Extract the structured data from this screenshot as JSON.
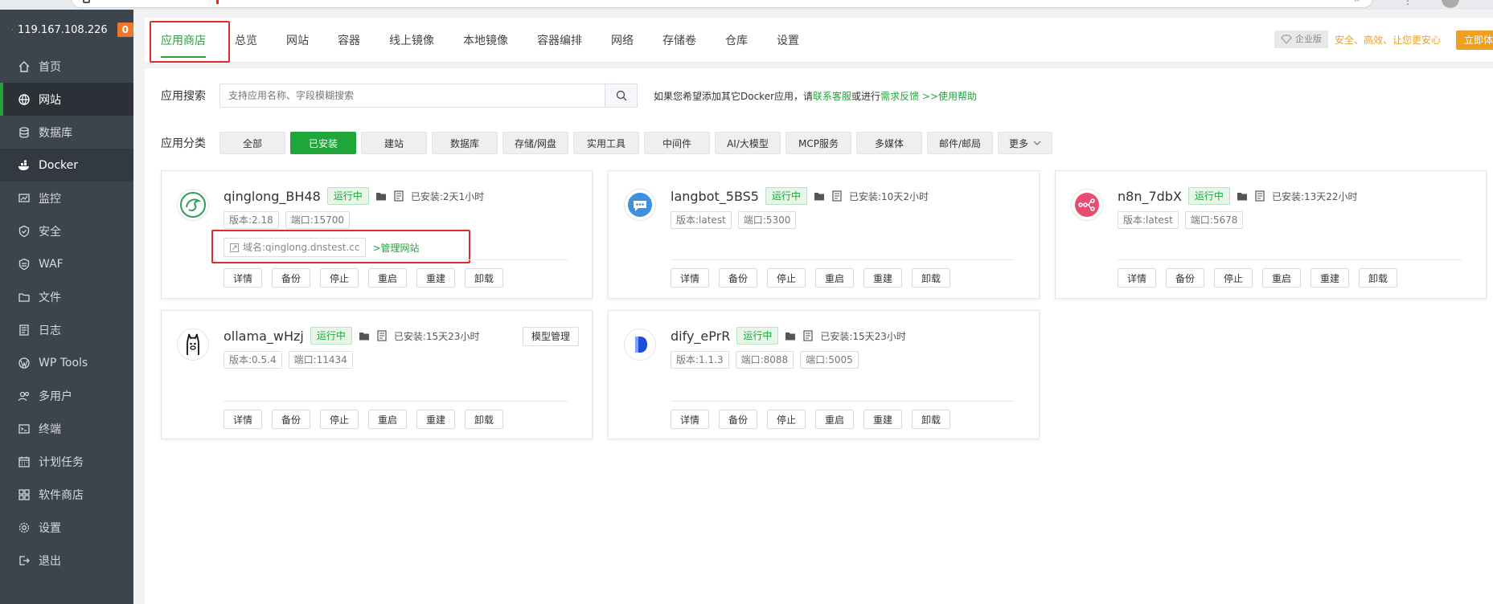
{
  "sidebar": {
    "host": "119.167.108.226",
    "badge": "0",
    "items": [
      {
        "label": "首页",
        "icon": "home-icon"
      },
      {
        "label": "网站",
        "icon": "globe-icon"
      },
      {
        "label": "数据库",
        "icon": "database-icon"
      },
      {
        "label": "Docker",
        "icon": "docker-icon"
      },
      {
        "label": "监控",
        "icon": "monitor-icon"
      },
      {
        "label": "安全",
        "icon": "shield-icon"
      },
      {
        "label": "WAF",
        "icon": "waf-icon"
      },
      {
        "label": "文件",
        "icon": "folder-icon"
      },
      {
        "label": "日志",
        "icon": "log-icon"
      },
      {
        "label": "WP Tools",
        "icon": "wordpress-icon"
      },
      {
        "label": "多用户",
        "icon": "users-icon"
      },
      {
        "label": "终端",
        "icon": "terminal-icon"
      },
      {
        "label": "计划任务",
        "icon": "calendar-icon"
      },
      {
        "label": "软件商店",
        "icon": "apps-icon"
      },
      {
        "label": "设置",
        "icon": "gear-icon"
      },
      {
        "label": "退出",
        "icon": "logout-icon"
      }
    ]
  },
  "tabs": [
    "应用商店",
    "总览",
    "网站",
    "容器",
    "线上镜像",
    "本地镜像",
    "容器编排",
    "网络",
    "存储卷",
    "仓库",
    "设置"
  ],
  "enterprise": {
    "badge": "企业版",
    "slogan": "安全、高效、让您更安心",
    "button": "立即体验"
  },
  "search": {
    "label": "应用搜索",
    "placeholder": "支持应用名称、字段模糊搜索",
    "hint_prefix": "如果您希望添加其它Docker应用，请",
    "hint_link1": "联系客服",
    "hint_mid": "或进行",
    "hint_link2": "需求反馈",
    "hint_sep": " >>",
    "hint_link3": "使用帮助"
  },
  "categories": {
    "label": "应用分类",
    "items": [
      "全部",
      "已安装",
      "建站",
      "数据库",
      "存储/网盘",
      "实用工具",
      "中间件",
      "AI/大模型",
      "MCP服务",
      "多媒体",
      "邮件/邮局"
    ],
    "more": "更多"
  },
  "actions": [
    "详情",
    "备份",
    "停止",
    "重启",
    "重建",
    "卸载"
  ],
  "apps": [
    {
      "name": "qinglong_BH48",
      "status": "运行中",
      "installed": "已安装:2天1小时",
      "version": "版本:2.18",
      "port": "端口:15700",
      "port2": "",
      "domain": "域名:qinglong.dnstest.cc",
      "manage": ">管理网站",
      "model": ""
    },
    {
      "name": "langbot_5BS5",
      "status": "运行中",
      "installed": "已安装:10天2小时",
      "version": "版本:latest",
      "port": "端口:5300",
      "port2": "",
      "domain": "",
      "manage": "",
      "model": ""
    },
    {
      "name": "n8n_7dbX",
      "status": "运行中",
      "installed": "已安装:13天22小时",
      "version": "版本:latest",
      "port": "端口:5678",
      "port2": "",
      "domain": "",
      "manage": "",
      "model": ""
    },
    {
      "name": "ollama_wHzj",
      "status": "运行中",
      "installed": "已安装:15天23小时",
      "version": "版本:0.5.4",
      "port": "端口:11434",
      "port2": "",
      "domain": "",
      "manage": "",
      "model": "模型管理"
    },
    {
      "name": "dify_ePrR",
      "status": "运行中",
      "installed": "已安装:15天23小时",
      "version": "版本:1.1.3",
      "port": "端口:8088",
      "port2": "端口:5005",
      "domain": "",
      "manage": "",
      "model": ""
    }
  ],
  "colors": {
    "accent": "#20a53a",
    "sidebar": "#3c444d",
    "highlight": "#e02b2b",
    "enterprise": "#f0a020"
  }
}
